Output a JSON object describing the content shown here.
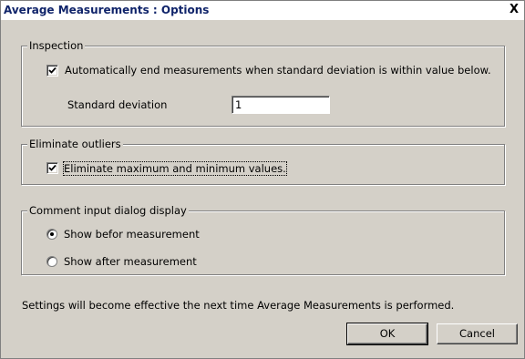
{
  "window": {
    "title": "Average Measurements : Options",
    "close_glyph": "X"
  },
  "inspection": {
    "legend": "Inspection",
    "auto_end_checked": true,
    "auto_end_label": "Automatically end measurements when standard deviation is within value below.",
    "stddev_label": "Standard deviation",
    "stddev_value": "1"
  },
  "outliers": {
    "legend": "Eliminate outliers",
    "eliminate_checked": true,
    "eliminate_label": "Eliminate maximum and minimum values."
  },
  "comment_dialog": {
    "legend": "Comment input dialog display",
    "options": [
      {
        "label": "Show befor measurement",
        "selected": true
      },
      {
        "label": "Show after measurement",
        "selected": false
      }
    ]
  },
  "footer": {
    "note": "Settings will become effective the next time Average Measurements is performed.",
    "ok_label": "OK",
    "cancel_label": "Cancel"
  }
}
